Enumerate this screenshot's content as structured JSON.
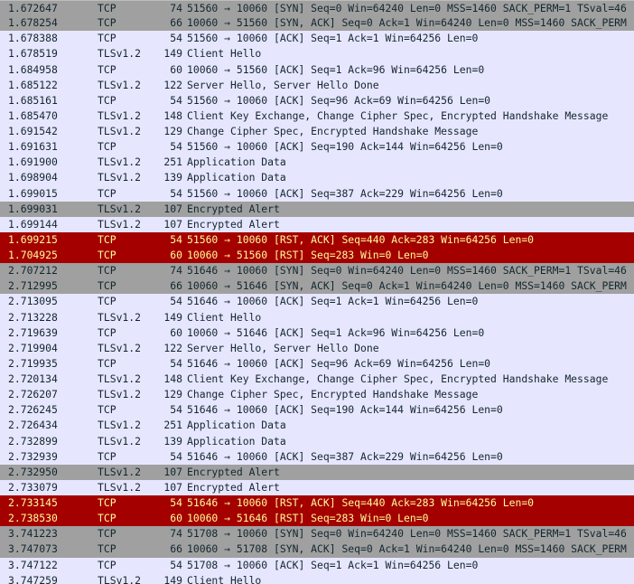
{
  "packets": [
    {
      "time": "1.672647",
      "protocol": "TCP",
      "length": "74",
      "info": "51560 → 10060 [SYN] Seq=0 Win=64240 Len=0 MSS=1460 SACK_PERM=1 TSval=46",
      "style": "syn"
    },
    {
      "time": "1.678254",
      "protocol": "TCP",
      "length": "66",
      "info": "10060 → 51560 [SYN, ACK] Seq=0 Ack=1 Win=64240 Len=0 MSS=1460 SACK_PERM",
      "style": "syn"
    },
    {
      "time": "1.678388",
      "protocol": "TCP",
      "length": "54",
      "info": "51560 → 10060 [ACK] Seq=1 Ack=1 Win=64256 Len=0",
      "style": "tcp"
    },
    {
      "time": "1.678519",
      "protocol": "TLSv1.2",
      "length": "149",
      "info": "Client Hello",
      "style": "tls"
    },
    {
      "time": "1.684958",
      "protocol": "TCP",
      "length": "60",
      "info": "10060 → 51560 [ACK] Seq=1 Ack=96 Win=64256 Len=0",
      "style": "tcp"
    },
    {
      "time": "1.685122",
      "protocol": "TLSv1.2",
      "length": "122",
      "info": "Server Hello, Server Hello Done",
      "style": "tls"
    },
    {
      "time": "1.685161",
      "protocol": "TCP",
      "length": "54",
      "info": "51560 → 10060 [ACK] Seq=96 Ack=69 Win=64256 Len=0",
      "style": "tcp"
    },
    {
      "time": "1.685470",
      "protocol": "TLSv1.2",
      "length": "148",
      "info": "Client Key Exchange, Change Cipher Spec, Encrypted Handshake Message",
      "style": "tls"
    },
    {
      "time": "1.691542",
      "protocol": "TLSv1.2",
      "length": "129",
      "info": "Change Cipher Spec, Encrypted Handshake Message",
      "style": "tls"
    },
    {
      "time": "1.691631",
      "protocol": "TCP",
      "length": "54",
      "info": "51560 → 10060 [ACK] Seq=190 Ack=144 Win=64256 Len=0",
      "style": "tcp"
    },
    {
      "time": "1.691900",
      "protocol": "TLSv1.2",
      "length": "251",
      "info": "Application Data",
      "style": "tls"
    },
    {
      "time": "1.698904",
      "protocol": "TLSv1.2",
      "length": "139",
      "info": "Application Data",
      "style": "tls"
    },
    {
      "time": "1.699015",
      "protocol": "TCP",
      "length": "54",
      "info": "51560 → 10060 [ACK] Seq=387 Ack=229 Win=64256 Len=0",
      "style": "tcp"
    },
    {
      "time": "1.699031",
      "protocol": "TLSv1.2",
      "length": "107",
      "info": "Encrypted Alert",
      "style": "alert"
    },
    {
      "time": "1.699144",
      "protocol": "TLSv1.2",
      "length": "107",
      "info": "Encrypted Alert",
      "style": "tls"
    },
    {
      "time": "1.699215",
      "protocol": "TCP",
      "length": "54",
      "info": "51560 → 10060 [RST, ACK] Seq=440 Ack=283 Win=64256 Len=0",
      "style": "rst"
    },
    {
      "time": "1.704925",
      "protocol": "TCP",
      "length": "60",
      "info": "10060 → 51560 [RST] Seq=283 Win=0 Len=0",
      "style": "rst"
    },
    {
      "time": "2.707212",
      "protocol": "TCP",
      "length": "74",
      "info": "51646 → 10060 [SYN] Seq=0 Win=64240 Len=0 MSS=1460 SACK_PERM=1 TSval=46",
      "style": "syn"
    },
    {
      "time": "2.712995",
      "protocol": "TCP",
      "length": "66",
      "info": "10060 → 51646 [SYN, ACK] Seq=0 Ack=1 Win=64240 Len=0 MSS=1460 SACK_PERM",
      "style": "syn"
    },
    {
      "time": "2.713095",
      "protocol": "TCP",
      "length": "54",
      "info": "51646 → 10060 [ACK] Seq=1 Ack=1 Win=64256 Len=0",
      "style": "tcp"
    },
    {
      "time": "2.713228",
      "protocol": "TLSv1.2",
      "length": "149",
      "info": "Client Hello",
      "style": "tls"
    },
    {
      "time": "2.719639",
      "protocol": "TCP",
      "length": "60",
      "info": "10060 → 51646 [ACK] Seq=1 Ack=96 Win=64256 Len=0",
      "style": "tcp"
    },
    {
      "time": "2.719904",
      "protocol": "TLSv1.2",
      "length": "122",
      "info": "Server Hello, Server Hello Done",
      "style": "tls"
    },
    {
      "time": "2.719935",
      "protocol": "TCP",
      "length": "54",
      "info": "51646 → 10060 [ACK] Seq=96 Ack=69 Win=64256 Len=0",
      "style": "tcp"
    },
    {
      "time": "2.720134",
      "protocol": "TLSv1.2",
      "length": "148",
      "info": "Client Key Exchange, Change Cipher Spec, Encrypted Handshake Message",
      "style": "tls"
    },
    {
      "time": "2.726207",
      "protocol": "TLSv1.2",
      "length": "129",
      "info": "Change Cipher Spec, Encrypted Handshake Message",
      "style": "tls"
    },
    {
      "time": "2.726245",
      "protocol": "TCP",
      "length": "54",
      "info": "51646 → 10060 [ACK] Seq=190 Ack=144 Win=64256 Len=0",
      "style": "tcp"
    },
    {
      "time": "2.726434",
      "protocol": "TLSv1.2",
      "length": "251",
      "info": "Application Data",
      "style": "tls"
    },
    {
      "time": "2.732899",
      "protocol": "TLSv1.2",
      "length": "139",
      "info": "Application Data",
      "style": "tls"
    },
    {
      "time": "2.732939",
      "protocol": "TCP",
      "length": "54",
      "info": "51646 → 10060 [ACK] Seq=387 Ack=229 Win=64256 Len=0",
      "style": "tcp"
    },
    {
      "time": "2.732950",
      "protocol": "TLSv1.2",
      "length": "107",
      "info": "Encrypted Alert",
      "style": "alert"
    },
    {
      "time": "2.733079",
      "protocol": "TLSv1.2",
      "length": "107",
      "info": "Encrypted Alert",
      "style": "tls"
    },
    {
      "time": "2.733145",
      "protocol": "TCP",
      "length": "54",
      "info": "51646 → 10060 [RST, ACK] Seq=440 Ack=283 Win=64256 Len=0",
      "style": "rst"
    },
    {
      "time": "2.738530",
      "protocol": "TCP",
      "length": "60",
      "info": "10060 → 51646 [RST] Seq=283 Win=0 Len=0",
      "style": "rst"
    },
    {
      "time": "3.741223",
      "protocol": "TCP",
      "length": "74",
      "info": "51708 → 10060 [SYN] Seq=0 Win=64240 Len=0 MSS=1460 SACK_PERM=1 TSval=46",
      "style": "syn"
    },
    {
      "time": "3.747073",
      "protocol": "TCP",
      "length": "66",
      "info": "10060 → 51708 [SYN, ACK] Seq=0 Ack=1 Win=64240 Len=0 MSS=1460 SACK_PERM",
      "style": "syn"
    },
    {
      "time": "3.747122",
      "protocol": "TCP",
      "length": "54",
      "info": "51708 → 10060 [ACK] Seq=1 Ack=1 Win=64256 Len=0",
      "style": "tcp"
    },
    {
      "time": "3.747259",
      "protocol": "TLSv1.2",
      "length": "149",
      "info": "Client Hello",
      "style": "tls"
    }
  ]
}
